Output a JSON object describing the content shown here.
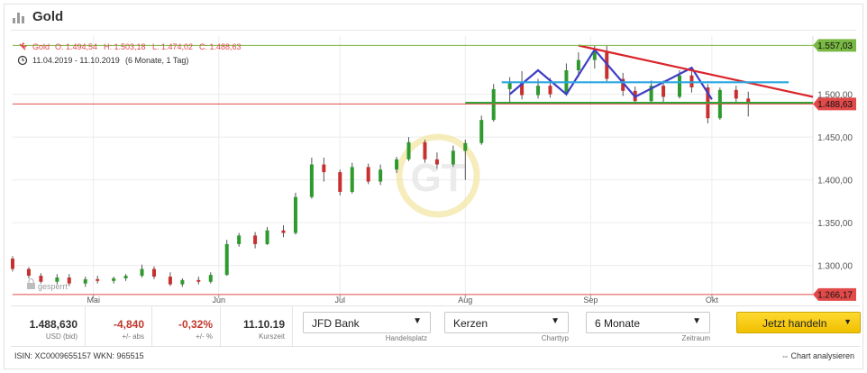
{
  "header": {
    "title": "Gold",
    "icon": "bar-chart-icon"
  },
  "chart_data": {
    "type": "candlestick",
    "instrument": "Gold",
    "ohlc_line": {
      "label": "Gold",
      "open": "O: 1.494,54",
      "high": "H: 1.503,18",
      "low": "L: 1.474,02",
      "close": "C: 1.488,63"
    },
    "period_line": "11.04.2019 - 11.10.2019",
    "period_detail": "(6 Monate, 1 Tag)",
    "ylim": [
      1266,
      1568
    ],
    "yticks": [
      {
        "value": 1300,
        "label": "1.300,00"
      },
      {
        "value": 1350,
        "label": "1.350,00"
      },
      {
        "value": 1400,
        "label": "1.400,00"
      },
      {
        "value": 1450,
        "label": "1.450,00"
      },
      {
        "value": 1500,
        "label": "1.500,00"
      }
    ],
    "xticks": [
      {
        "date": "2019-05-01",
        "label": "Mai"
      },
      {
        "date": "2019-06-01",
        "label": "Jun"
      },
      {
        "date": "2019-07-01",
        "label": "Jul"
      },
      {
        "date": "2019-08-01",
        "label": "Aug"
      },
      {
        "date": "2019-09-01",
        "label": "Sep"
      },
      {
        "date": "2019-10-01",
        "label": "Okt"
      }
    ],
    "xrange": [
      "2019-04-11",
      "2019-10-26"
    ],
    "markers": [
      {
        "value": 1557.03,
        "label": "1.557,03",
        "color": "#79b843"
      },
      {
        "value": 1488.63,
        "label": "1.488,63",
        "color": "#e24a4a"
      },
      {
        "value": 1266.17,
        "label": "1.266,17",
        "color": "#e24a4a"
      }
    ],
    "candles": [
      {
        "d": "2019-04-11",
        "o": 1308,
        "h": 1311,
        "l": 1293,
        "c": 1296
      },
      {
        "d": "2019-04-15",
        "o": 1296,
        "h": 1298,
        "l": 1285,
        "c": 1288
      },
      {
        "d": "2019-04-18",
        "o": 1288,
        "h": 1291,
        "l": 1279,
        "c": 1281
      },
      {
        "d": "2019-04-22",
        "o": 1281,
        "h": 1290,
        "l": 1278,
        "c": 1286
      },
      {
        "d": "2019-04-25",
        "o": 1286,
        "h": 1290,
        "l": 1276,
        "c": 1279
      },
      {
        "d": "2019-04-29",
        "o": 1279,
        "h": 1287,
        "l": 1275,
        "c": 1284
      },
      {
        "d": "2019-05-02",
        "o": 1284,
        "h": 1288,
        "l": 1279,
        "c": 1282
      },
      {
        "d": "2019-05-06",
        "o": 1282,
        "h": 1287,
        "l": 1279,
        "c": 1285
      },
      {
        "d": "2019-05-09",
        "o": 1285,
        "h": 1290,
        "l": 1282,
        "c": 1288
      },
      {
        "d": "2019-05-13",
        "o": 1288,
        "h": 1301,
        "l": 1286,
        "c": 1296
      },
      {
        "d": "2019-05-16",
        "o": 1296,
        "h": 1299,
        "l": 1284,
        "c": 1287
      },
      {
        "d": "2019-05-20",
        "o": 1287,
        "h": 1292,
        "l": 1276,
        "c": 1278
      },
      {
        "d": "2019-05-23",
        "o": 1278,
        "h": 1285,
        "l": 1275,
        "c": 1283
      },
      {
        "d": "2019-05-27",
        "o": 1283,
        "h": 1287,
        "l": 1278,
        "c": 1281
      },
      {
        "d": "2019-05-30",
        "o": 1281,
        "h": 1292,
        "l": 1279,
        "c": 1289
      },
      {
        "d": "2019-06-03",
        "o": 1289,
        "h": 1330,
        "l": 1288,
        "c": 1325
      },
      {
        "d": "2019-06-06",
        "o": 1325,
        "h": 1338,
        "l": 1322,
        "c": 1335
      },
      {
        "d": "2019-06-10",
        "o": 1335,
        "h": 1339,
        "l": 1320,
        "c": 1325
      },
      {
        "d": "2019-06-13",
        "o": 1325,
        "h": 1345,
        "l": 1324,
        "c": 1341
      },
      {
        "d": "2019-06-17",
        "o": 1341,
        "h": 1347,
        "l": 1333,
        "c": 1338
      },
      {
        "d": "2019-06-20",
        "o": 1338,
        "h": 1385,
        "l": 1336,
        "c": 1380
      },
      {
        "d": "2019-06-24",
        "o": 1380,
        "h": 1426,
        "l": 1378,
        "c": 1418
      },
      {
        "d": "2019-06-27",
        "o": 1418,
        "h": 1426,
        "l": 1398,
        "c": 1409
      },
      {
        "d": "2019-07-01",
        "o": 1409,
        "h": 1412,
        "l": 1382,
        "c": 1386
      },
      {
        "d": "2019-07-04",
        "o": 1386,
        "h": 1420,
        "l": 1384,
        "c": 1415
      },
      {
        "d": "2019-07-08",
        "o": 1415,
        "h": 1419,
        "l": 1395,
        "c": 1398
      },
      {
        "d": "2019-07-11",
        "o": 1398,
        "h": 1418,
        "l": 1394,
        "c": 1412
      },
      {
        "d": "2019-07-15",
        "o": 1412,
        "h": 1427,
        "l": 1408,
        "c": 1424
      },
      {
        "d": "2019-07-18",
        "o": 1424,
        "h": 1450,
        "l": 1422,
        "c": 1444
      },
      {
        "d": "2019-07-22",
        "o": 1444,
        "h": 1447,
        "l": 1420,
        "c": 1424
      },
      {
        "d": "2019-07-25",
        "o": 1424,
        "h": 1432,
        "l": 1413,
        "c": 1418
      },
      {
        "d": "2019-07-29",
        "o": 1418,
        "h": 1440,
        "l": 1415,
        "c": 1434
      },
      {
        "d": "2019-08-01",
        "o": 1434,
        "h": 1447,
        "l": 1400,
        "c": 1443
      },
      {
        "d": "2019-08-05",
        "o": 1443,
        "h": 1475,
        "l": 1441,
        "c": 1470
      },
      {
        "d": "2019-08-08",
        "o": 1470,
        "h": 1512,
        "l": 1468,
        "c": 1506
      },
      {
        "d": "2019-08-12",
        "o": 1506,
        "h": 1520,
        "l": 1490,
        "c": 1513
      },
      {
        "d": "2019-08-15",
        "o": 1513,
        "h": 1527,
        "l": 1494,
        "c": 1499
      },
      {
        "d": "2019-08-19",
        "o": 1499,
        "h": 1518,
        "l": 1495,
        "c": 1510
      },
      {
        "d": "2019-08-22",
        "o": 1510,
        "h": 1519,
        "l": 1496,
        "c": 1500
      },
      {
        "d": "2019-08-26",
        "o": 1500,
        "h": 1536,
        "l": 1498,
        "c": 1528
      },
      {
        "d": "2019-08-29",
        "o": 1528,
        "h": 1549,
        "l": 1520,
        "c": 1540
      },
      {
        "d": "2019-09-02",
        "o": 1540,
        "h": 1557,
        "l": 1530,
        "c": 1550
      },
      {
        "d": "2019-09-05",
        "o": 1550,
        "h": 1557,
        "l": 1514,
        "c": 1518
      },
      {
        "d": "2019-09-09",
        "o": 1518,
        "h": 1525,
        "l": 1498,
        "c": 1504
      },
      {
        "d": "2019-09-12",
        "o": 1504,
        "h": 1509,
        "l": 1488,
        "c": 1492
      },
      {
        "d": "2019-09-16",
        "o": 1492,
        "h": 1516,
        "l": 1490,
        "c": 1510
      },
      {
        "d": "2019-09-19",
        "o": 1510,
        "h": 1516,
        "l": 1490,
        "c": 1497
      },
      {
        "d": "2019-09-23",
        "o": 1497,
        "h": 1528,
        "l": 1495,
        "c": 1522
      },
      {
        "d": "2019-09-26",
        "o": 1522,
        "h": 1532,
        "l": 1502,
        "c": 1508
      },
      {
        "d": "2019-09-30",
        "o": 1508,
        "h": 1512,
        "l": 1466,
        "c": 1472
      },
      {
        "d": "2019-10-03",
        "o": 1472,
        "h": 1508,
        "l": 1470,
        "c": 1505
      },
      {
        "d": "2019-10-07",
        "o": 1505,
        "h": 1510,
        "l": 1490,
        "c": 1495
      },
      {
        "d": "2019-10-10",
        "o": 1495,
        "h": 1503,
        "l": 1474,
        "c": 1489
      }
    ],
    "pattern_lines": [
      {
        "name": "double-top-pattern",
        "color": "#3d3dc8",
        "points": [
          [
            "2019-08-12",
            1500
          ],
          [
            "2019-08-19",
            1528
          ],
          [
            "2019-08-26",
            1500
          ],
          [
            "2019-09-02",
            1552
          ],
          [
            "2019-09-12",
            1497
          ],
          [
            "2019-09-26",
            1531
          ],
          [
            "2019-10-01",
            1494
          ]
        ]
      },
      {
        "name": "falling-trendline",
        "color": "#d9262b",
        "points": [
          [
            "2019-08-29",
            1557
          ],
          [
            "2019-10-26",
            1497
          ]
        ]
      },
      {
        "name": "upper-horizontal-line",
        "color": "#2aa5e0",
        "points": [
          [
            "2019-08-10",
            1514
          ],
          [
            "2019-10-20",
            1514
          ]
        ]
      },
      {
        "name": "lower-horizontal-line",
        "color": "#27a838",
        "points": [
          [
            "2019-08-01",
            1490
          ],
          [
            "2019-10-26",
            1490
          ]
        ]
      }
    ],
    "watermark_label": "gesperrt"
  },
  "bottom": {
    "stats": [
      {
        "value": "1.488,630",
        "label": "USD (bid)",
        "color": "#222222"
      },
      {
        "value": "-4,840",
        "label": "+/- abs",
        "color": "#c0392b"
      },
      {
        "value": "-0,32%",
        "label": "+/- %",
        "color": "#c0392b"
      },
      {
        "value": "11.10.19",
        "label": "Kurszeit",
        "color": "#222222"
      }
    ],
    "selects": [
      {
        "value": "JFD Bank",
        "label": "Handelsplatz"
      },
      {
        "value": "Kerzen",
        "label": "Charttyp"
      },
      {
        "value": "6 Monate",
        "label": "Zeitraum"
      }
    ],
    "trade_button": "Jetzt handeln"
  },
  "footer": {
    "isin": "ISIN: XC0009655157 WKN: 965515",
    "analyze": "Chart analysieren"
  }
}
